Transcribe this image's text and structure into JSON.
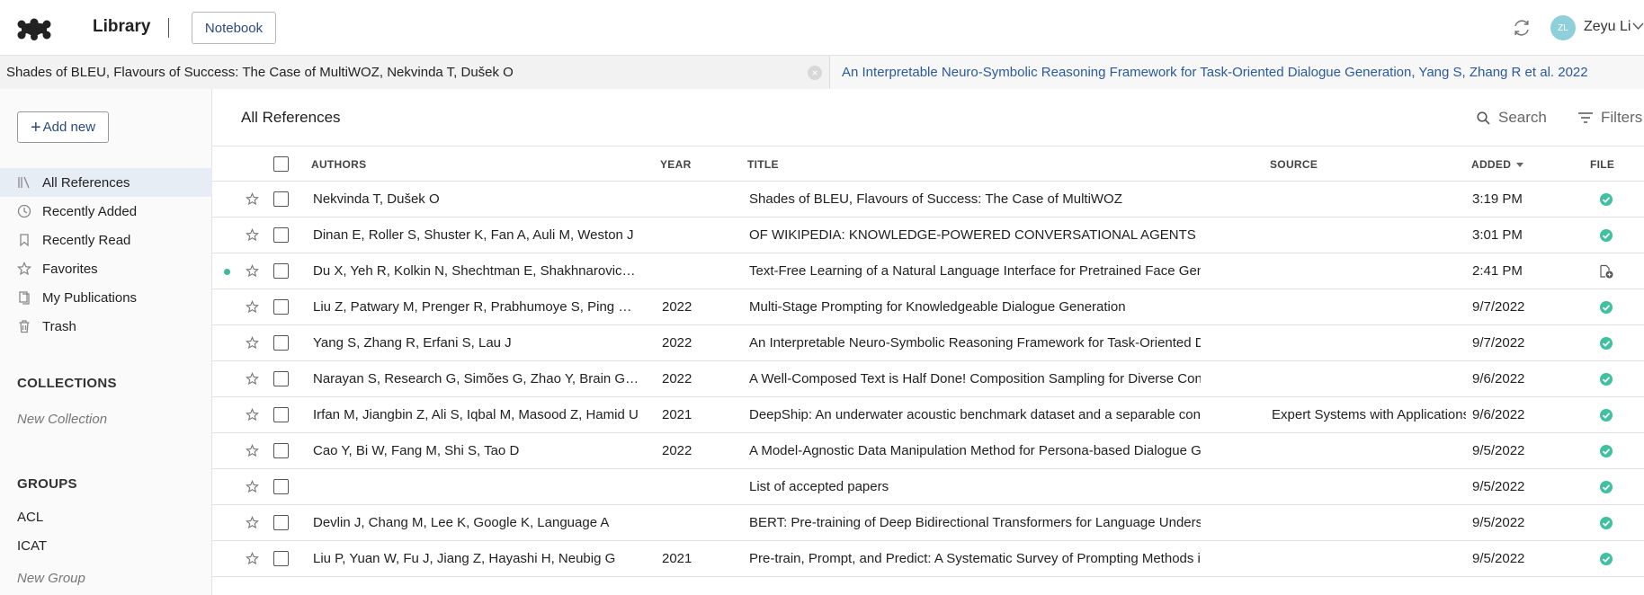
{
  "header": {
    "app_title": "Library",
    "notebook_label": "Notebook",
    "user": {
      "initials": "ZL",
      "name": "Zeyu Li"
    }
  },
  "tabs": [
    {
      "label": "Shades of BLEU, Flavours of Success: The Case of MultiWOZ, Nekvinda T, Dušek O",
      "active": true
    },
    {
      "label": "An Interpretable Neuro-Symbolic Reasoning Framework for Task-Oriented Dialogue Generation, Yang S, Zhang R et al. 2022",
      "active": false
    }
  ],
  "sidebar": {
    "add_new_label": "Add new",
    "nav": [
      {
        "label": "All References",
        "icon": "library-icon",
        "active": true
      },
      {
        "label": "Recently Added",
        "icon": "clock-icon",
        "active": false
      },
      {
        "label": "Recently Read",
        "icon": "bookmark-icon",
        "active": false
      },
      {
        "label": "Favorites",
        "icon": "star-icon",
        "active": false
      },
      {
        "label": "My Publications",
        "icon": "publications-icon",
        "active": false
      },
      {
        "label": "Trash",
        "icon": "trash-icon",
        "active": false
      }
    ],
    "collections_title": "COLLECTIONS",
    "new_collection_label": "New Collection",
    "groups_title": "GROUPS",
    "groups": [
      "ACL",
      "ICAT"
    ],
    "new_group_label": "New Group"
  },
  "main": {
    "title": "All References",
    "search_label": "Search",
    "filters_label": "Filters",
    "columns": {
      "authors": "AUTHORS",
      "year": "YEAR",
      "title": "TITLE",
      "source": "SOURCE",
      "added": "ADDED",
      "file": "FILE"
    },
    "sort": {
      "column": "added",
      "direction": "descending"
    },
    "rows": [
      {
        "unread": false,
        "authors": "Nekvinda T, Dušek O",
        "year": "",
        "title": "Shades of BLEU, Flavours of Success: The Case of MultiWOZ",
        "source": "",
        "added": "3:19 PM",
        "file": "check-icon"
      },
      {
        "unread": false,
        "authors": "Dinan E, Roller S, Shuster K, Fan A, Auli M, Weston J",
        "year": "",
        "title": "OF WIKIPEDIA: KNOWLEDGE-POWERED CONVERSATIONAL AGENTS",
        "source": "",
        "added": "3:01 PM",
        "file": "check-icon"
      },
      {
        "unread": true,
        "authors": "Du X, Yeh R, Kolkin N, Shechtman E, Shakhnarovich G",
        "year": "",
        "title": "Text-Free Learning of a Natural Language Interface for Pretrained Face Generators",
        "source": "",
        "added": "2:41 PM",
        "file": "add-file-icon"
      },
      {
        "unread": false,
        "authors": "Liu Z, Patwary M, Prenger R, Prabhumoye S, Ping W, Sh…",
        "year": "2022",
        "title": "Multi-Stage Prompting for Knowledgeable Dialogue Generation",
        "source": "",
        "added": "9/7/2022",
        "file": "check-icon"
      },
      {
        "unread": false,
        "authors": "Yang S, Zhang R, Erfani S, Lau J",
        "year": "2022",
        "title": "An Interpretable Neuro-Symbolic Reasoning Framework for Task-Oriented Dialogue Genera",
        "source": "",
        "added": "9/7/2022",
        "file": "check-icon"
      },
      {
        "unread": false,
        "authors": "Narayan S, Research G, Simões G, Zhao Y, Brain G, Ma…",
        "year": "2022",
        "title": "A Well-Composed Text is Half Done! Composition Sampling for Diverse Conditional Generat",
        "source": "",
        "added": "9/6/2022",
        "file": "check-icon"
      },
      {
        "unread": false,
        "authors": "Irfan M, Jiangbin Z, Ali S, Iqbal M, Masood Z, Hamid U",
        "year": "2021",
        "title": "DeepShip: An underwater acoustic benchmark dataset and a separable convolution based a",
        "source": "Expert Systems with Applications",
        "added": "9/6/2022",
        "file": "check-icon"
      },
      {
        "unread": false,
        "authors": "Cao Y, Bi W, Fang M, Shi S, Tao D",
        "year": "2022",
        "title": "A Model-Agnostic Data Manipulation Method for Persona-based Dialogue Generation",
        "source": "",
        "added": "9/5/2022",
        "file": "check-icon"
      },
      {
        "unread": false,
        "authors": "",
        "year": "",
        "title": "List of accepted papers",
        "source": "",
        "added": "9/5/2022",
        "file": "check-icon"
      },
      {
        "unread": false,
        "authors": "Devlin J, Chang M, Lee K, Google K, Language A",
        "year": "",
        "title": "BERT: Pre-training of Deep Bidirectional Transformers for Language Understanding",
        "source": "",
        "added": "9/5/2022",
        "file": "check-icon"
      },
      {
        "unread": false,
        "authors": "Liu P, Yuan W, Fu J, Jiang Z, Hayashi H, Neubig G",
        "year": "2021",
        "title": "Pre-train, Prompt, and Predict: A Systematic Survey of Prompting Methods in Natural Langu",
        "source": "",
        "added": "9/5/2022",
        "file": "check-icon"
      }
    ]
  },
  "colors": {
    "accent": "#2a4a7c",
    "file_ok": "#3fc1a0",
    "unread": "#3fb89a",
    "active_nav_bg": "#e7edf5",
    "avatar_bg": "#8fcfda"
  }
}
